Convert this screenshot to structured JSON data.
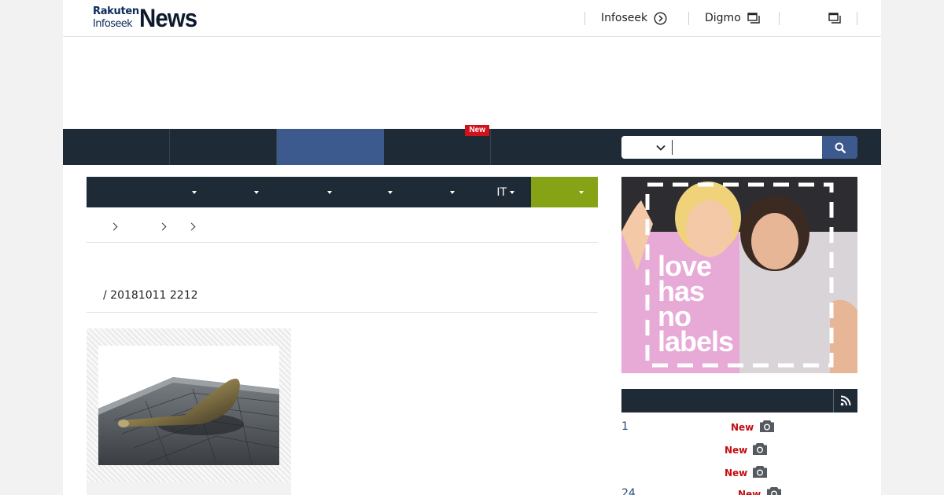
{
  "header": {
    "logo": {
      "line1": "Rakuten",
      "line2": "Infoseek",
      "wordmark": "News"
    },
    "links": [
      {
        "label": "Infoseek",
        "icon": "circle-arrow-right-icon"
      },
      {
        "label": "Digmo",
        "icon": "external-window-icon"
      },
      {
        "label": "",
        "icon": "external-window-icon"
      }
    ]
  },
  "nav": {
    "new_badge": "New",
    "search": {
      "placeholder": "",
      "value": ""
    }
  },
  "categories": [
    {
      "label": ""
    },
    {
      "label": ""
    },
    {
      "label": ""
    },
    {
      "label": ""
    },
    {
      "label": ""
    },
    {
      "label": "IT"
    },
    {
      "label": ""
    }
  ],
  "article": {
    "date": "/ 20181011 2212"
  },
  "banner": {
    "lines": [
      "love",
      "has",
      "no",
      "labels"
    ]
  },
  "ranking": {
    "new_label": "New",
    "rows": [
      {
        "num": "1",
        "new": "New"
      },
      {
        "num": "",
        "new": "New"
      },
      {
        "num": "",
        "new": "New"
      },
      {
        "num": "24",
        "new": "New"
      }
    ]
  },
  "colors": {
    "nav_bg": "#1f2a37",
    "nav_active": "#3d5a8f",
    "category_active": "#86a315",
    "new_red": "#d0121b",
    "rank_link": "#2a4a7f"
  }
}
